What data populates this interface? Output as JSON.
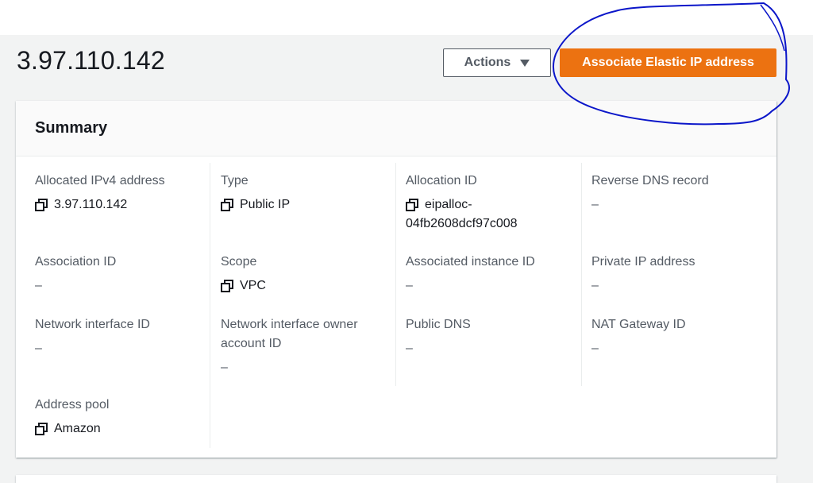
{
  "header": {
    "title": "3.97.110.142",
    "actions_label": "Actions",
    "primary_label": "Associate Elastic IP address"
  },
  "summary": {
    "title": "Summary",
    "fields": {
      "allocated_ipv4": {
        "label": "Allocated IPv4 address",
        "value": "3.97.110.142"
      },
      "type": {
        "label": "Type",
        "value": "Public IP"
      },
      "allocation_id": {
        "label": "Allocation ID",
        "value_line1": "eipalloc-",
        "value_line2": "04fb2608dcf97c008"
      },
      "reverse_dns": {
        "label": "Reverse DNS record",
        "value": "–"
      },
      "association_id": {
        "label": "Association ID",
        "value": "–"
      },
      "scope": {
        "label": "Scope",
        "value": "VPC"
      },
      "associated_instance_id": {
        "label": "Associated instance ID",
        "value": "–"
      },
      "private_ip": {
        "label": "Private IP address",
        "value": "–"
      },
      "network_interface_id": {
        "label": "Network interface ID",
        "value": "–"
      },
      "ni_owner_account": {
        "label_line1": "Network interface owner",
        "label_line2": "account ID",
        "value": "–"
      },
      "public_dns": {
        "label": "Public DNS",
        "value": "–"
      },
      "nat_gateway_id": {
        "label": "NAT Gateway ID",
        "value": "–"
      },
      "address_pool": {
        "label": "Address pool",
        "value": "Amazon"
      }
    }
  },
  "icons": {
    "copy": "copy-icon",
    "caret": "caret-down-icon"
  },
  "colors": {
    "primary": "#ec7211",
    "annotation": "#0b16c9",
    "text": "#16191f",
    "label": "#545b64"
  }
}
